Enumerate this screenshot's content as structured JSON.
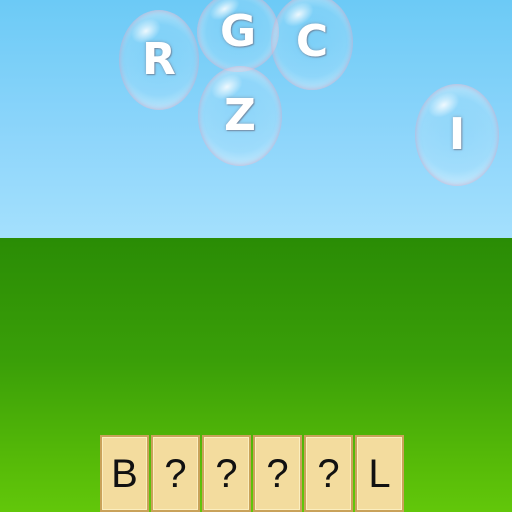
{
  "bubbles": [
    {
      "id": "r",
      "letter": "R"
    },
    {
      "id": "g",
      "letter": "G"
    },
    {
      "id": "c",
      "letter": "C"
    },
    {
      "id": "z",
      "letter": "Z"
    },
    {
      "id": "i",
      "letter": "I"
    }
  ],
  "word_tiles": [
    "B",
    "?",
    "?",
    "?",
    "?",
    "L"
  ],
  "colors": {
    "sky": "#8fd6fb",
    "grass": "#3a9f08",
    "tile": "#f3dc9e",
    "tile_border": "#c9a25a"
  }
}
